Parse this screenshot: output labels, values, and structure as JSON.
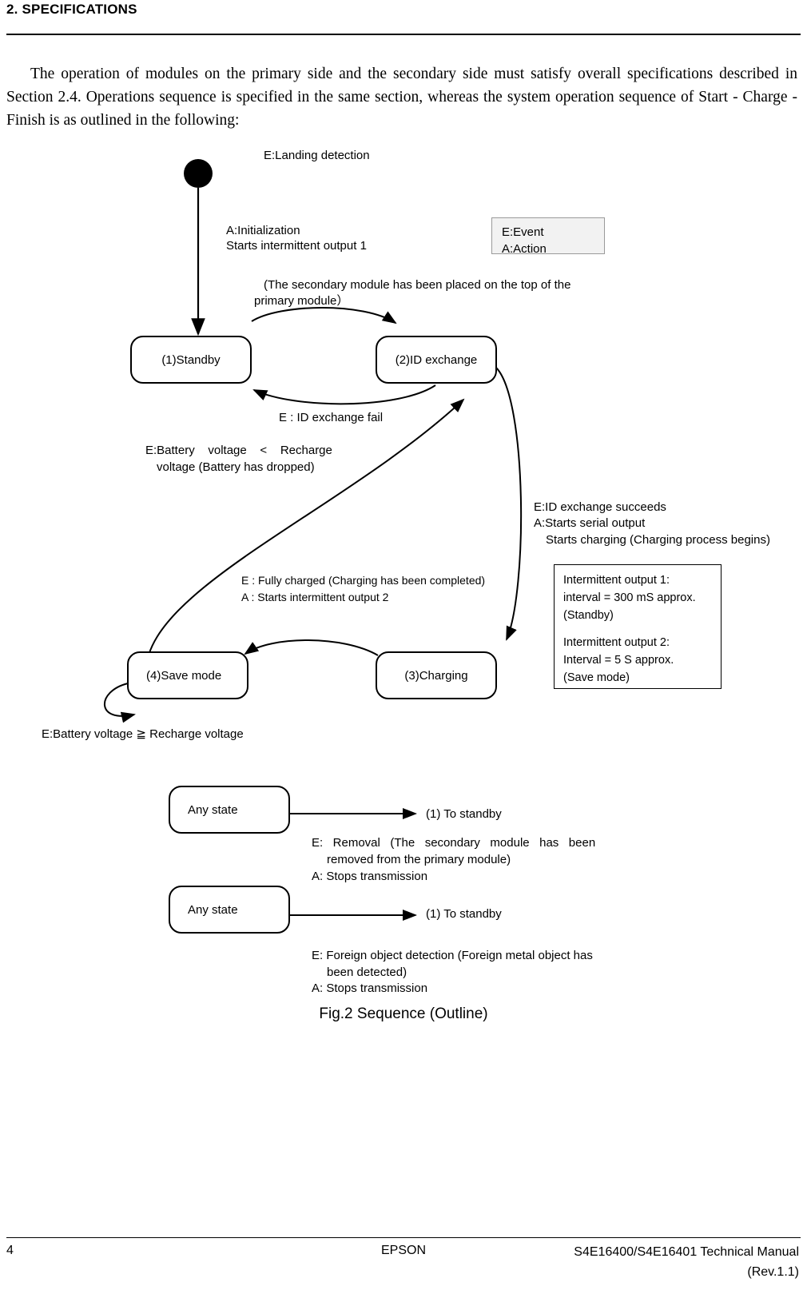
{
  "header": {
    "section_title": "2. SPECIFICATIONS"
  },
  "intro": {
    "paragraph": "The operation of modules on the primary side and the secondary side must satisfy overall specifications described in Section 2.4. Operations sequence is specified in the same section, whereas the system operation sequence of Start - Charge - Finish is as outlined in the following:"
  },
  "diagram": {
    "legend": {
      "line1": "E:Event",
      "line2": "A:Action"
    },
    "start_label_line1": "A:Initialization",
    "start_label_line2": "Starts intermittent output 1",
    "landing_line1": "E:Landing detection",
    "landing_line2": "(The secondary module has been placed on the top of the",
    "landing_line3": "primary module）",
    "states": {
      "standby": "(1)Standby",
      "id_exchange": "(2)ID exchange",
      "save_mode": "(4)Save mode",
      "charging": "(3)Charging"
    },
    "id_fail": "E : ID exchange fail",
    "battery_low_line1": "E:Battery    voltage    <    Recharge",
    "battery_low_line2": "voltage (Battery has dropped)",
    "id_success_line1": "E:ID exchange succeeds",
    "id_success_line2": "A:Starts serial output",
    "id_success_line3": "Starts charging (Charging process begins)",
    "fully_charged_line1": "E : Fully charged (Charging has been completed)",
    "fully_charged_line2": "A : Starts intermittent output 2",
    "note": {
      "line1": "Intermittent output 1:",
      "line2": "interval    =    300    mS    approx.",
      "line3": "(Standby)",
      "line4": "Intermittent output 2:",
      "line5": "Interval = 5 S approx.",
      "line6": "(Save mode)"
    },
    "recharge_ok": "E:Battery voltage ≧ Recharge voltage",
    "any_state_1": "Any state",
    "to_standby_1": "(1) To standby",
    "removal_line1": "E:   Removal   (The   secondary   module   has   been",
    "removal_line2": "removed from the primary module)",
    "removal_line3": "A: Stops transmission",
    "any_state_2": "Any state",
    "to_standby_2": "(1) To standby",
    "foreign_line1": "E: Foreign object detection (Foreign metal object has",
    "foreign_line2": "been detected)",
    "foreign_line3": "A: Stops transmission",
    "caption": "Fig.2    Sequence (Outline)"
  },
  "footer": {
    "page_number": "4",
    "brand": "EPSON",
    "manual_line1": "S4E16400/S4E16401 Technical Manual",
    "manual_line2": "(Rev.1.1)"
  }
}
